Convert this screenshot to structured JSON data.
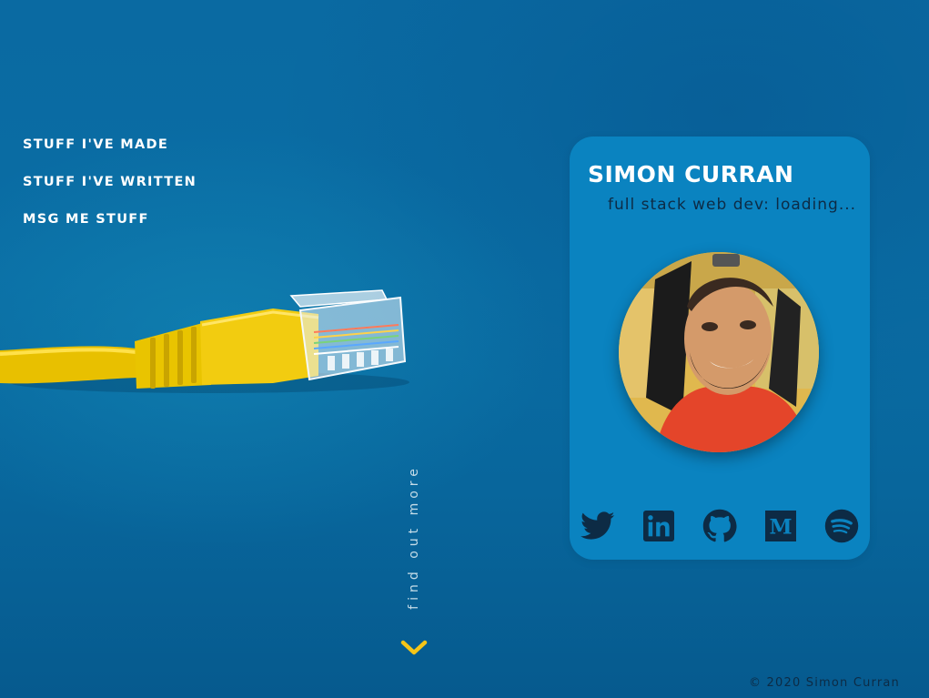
{
  "nav": {
    "items": [
      {
        "label": "STUFF I'VE MADE"
      },
      {
        "label": "STUFF I'VE WRITTEN"
      },
      {
        "label": "MSG ME STUFF"
      }
    ]
  },
  "scroll_hint": {
    "label": "find out more",
    "icon": "chevron-down-icon"
  },
  "profile_card": {
    "name": "SIMON CURRAN",
    "tagline": "full stack web dev: loading...",
    "avatar_alt": "Simon Curran",
    "social_icons": [
      "twitter-icon",
      "linkedin-icon",
      "github-icon",
      "medium-icon",
      "spotify-icon"
    ]
  },
  "footer": {
    "copyright": "© 2020 Simon Curran"
  },
  "colors": {
    "background": "#0a6aa2",
    "card": "#0a83c0",
    "icon_dark": "#0d2b45",
    "accent_yellow": "#f5c518",
    "text_white": "#ffffff"
  }
}
